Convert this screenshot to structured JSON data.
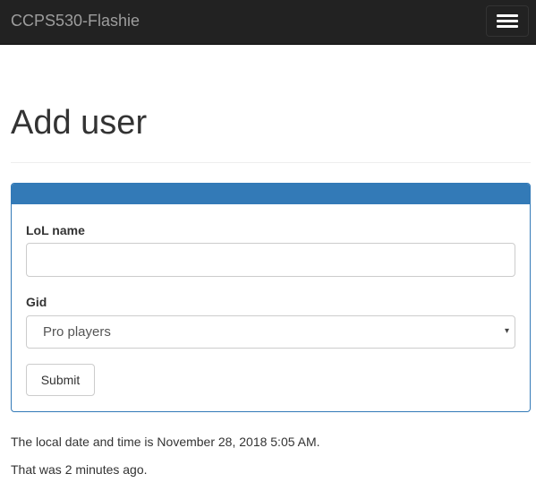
{
  "navbar": {
    "brand": "CCPS530-Flashie",
    "toggle_icon": "hamburger-menu-icon"
  },
  "page": {
    "title": "Add user"
  },
  "form": {
    "lol_name_label": "LoL name",
    "lol_name_value": "",
    "gid_label": "Gid",
    "gid_selected": "Pro players",
    "select_arrow": "▾",
    "submit_label": "Submit"
  },
  "footer": {
    "local_time": "The local date and time is November 28, 2018 5:05 AM.",
    "ago": "That was 2 minutes ago."
  },
  "colors": {
    "navbar_bg": "#222222",
    "brand_text": "#9d9d9d",
    "panel_primary": "#337ab7",
    "text": "#333333"
  }
}
